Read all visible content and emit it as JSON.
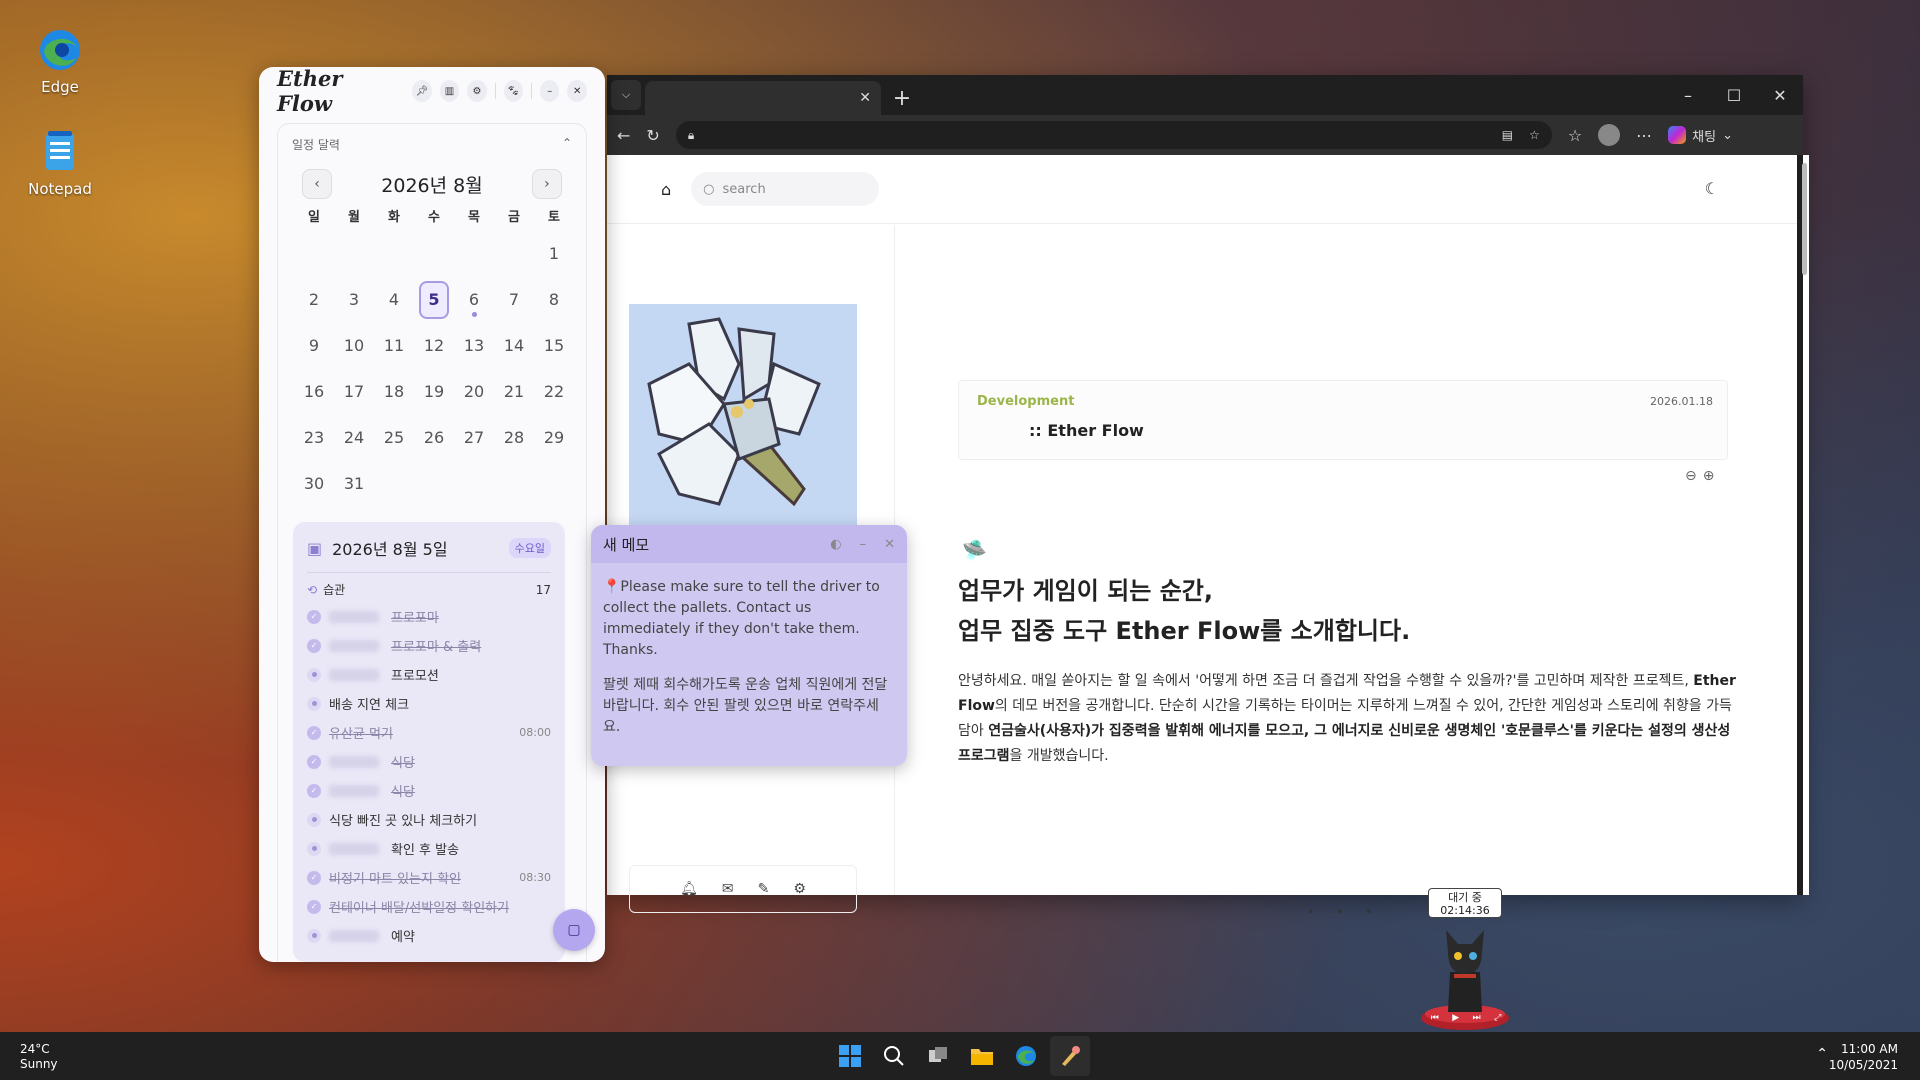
{
  "desktop": {
    "icons": [
      {
        "label": "Edge"
      },
      {
        "label": "Notepad"
      }
    ]
  },
  "etherflow": {
    "logo": "Ether Flow",
    "calendar": {
      "section_title": "일정 달력",
      "month_label": "2026년 8월",
      "weekdays": [
        "일",
        "월",
        "화",
        "수",
        "목",
        "금",
        "토"
      ],
      "days": [
        "",
        "",
        "",
        "",
        "",
        "",
        "1",
        "2",
        "3",
        "4",
        "5",
        "6",
        "7",
        "8",
        "9",
        "10",
        "11",
        "12",
        "13",
        "14",
        "15",
        "16",
        "17",
        "18",
        "19",
        "20",
        "21",
        "22",
        "23",
        "24",
        "25",
        "26",
        "27",
        "28",
        "29",
        "30",
        "31"
      ],
      "selected_day": "5"
    },
    "day_panel": {
      "date": "2026년 8월 5일",
      "weekday": "수요일",
      "habit_label": "습관",
      "habit_count": "17",
      "tasks": [
        {
          "text": "프로포마",
          "done": true,
          "time": ""
        },
        {
          "text": "프로포마 & 출력",
          "done": true,
          "time": ""
        },
        {
          "text": "프로모션",
          "done": false,
          "time": ""
        },
        {
          "text": "배송 지연 체크",
          "done": false,
          "time": ""
        },
        {
          "text": "유산균 먹기",
          "done": true,
          "time": "08:00"
        },
        {
          "text": "식당",
          "done": true,
          "time": ""
        },
        {
          "text": "식당",
          "done": true,
          "time": ""
        },
        {
          "text": "식당 빠진 곳 있나 체크하기",
          "done": false,
          "time": ""
        },
        {
          "text": "확인 후 발송",
          "done": false,
          "time": ""
        },
        {
          "text": "비정기 마트 있는지 확인",
          "done": true,
          "time": "08:30"
        },
        {
          "text": "컨테이너 배달/선박일정 확인하기",
          "done": true,
          "time": ""
        },
        {
          "text": "예약",
          "done": false,
          "time": ""
        }
      ]
    }
  },
  "browser": {
    "search_placeholder": "search",
    "chat_label": "채팅",
    "tab_close": "✕",
    "article": {
      "category": "Development",
      "date": "2026.01.18",
      "title": ":: Ether Flow",
      "heading_line1": "업무가 게임이 되는 순간,",
      "heading_line2": "업무 집중 도구 Ether Flow를 소개합니다.",
      "para_1": "안녕하세요. 매일 쏟아지는 할 일 속에서 '어떻게 하면 조금 더 즐겁게 작업을 수행할 수 있을까?'를 고민하며 제작한 프로젝트, ",
      "para_2": "Ether Flow",
      "para_3": "의 데모 버전을 공개합니다. 단순히 시간을 기록하는 타이머는 지루하게 느껴질 수 있어, 간단한 게임성과 스토리에 취향을 가득 담아 ",
      "para_4": "연금술사(사용자)가 집중력을 발휘해 에너지를 모으고, 그 에너지로 신비로운 생명체인 '호문클루스'를 키운다는 설정의 생산성 프로그램",
      "para_5": "을 개발했습니다."
    }
  },
  "memo": {
    "title": "새 메모",
    "body_en": "📍Please make sure to tell the driver to collect the pallets. Contact us immediately if they don't take them. Thanks.",
    "body_ko": "팔렛 제때 회수해가도록 운송 업체 직원에게 전달 바랍니다. 회수 안된 팔렛 있으면 바로 연락주세요."
  },
  "pet": {
    "status": "대기 중",
    "timer": "02:14:36"
  },
  "taskbar": {
    "temperature": "24°C",
    "weather": "Sunny",
    "time": "11:00 AM",
    "date": "10/05/2021"
  },
  "colors": {
    "accent": "#a79be6",
    "memo_bg": "#cfc8f1",
    "category": "#9cb54a"
  }
}
